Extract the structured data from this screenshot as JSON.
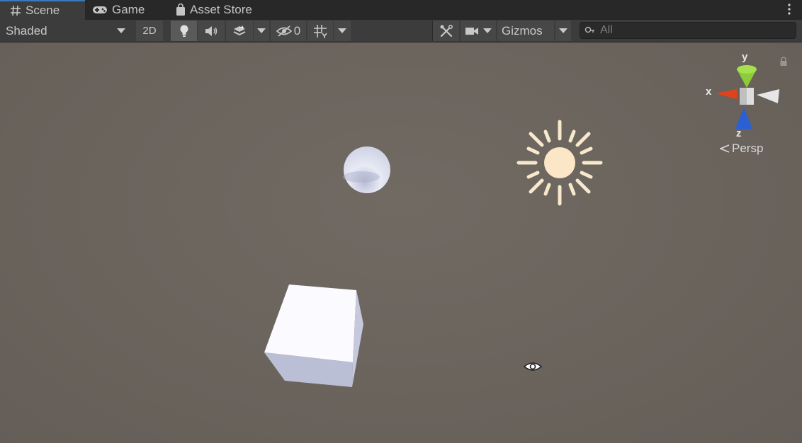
{
  "tabs": [
    {
      "label": "Scene",
      "icon": "grid-hash-icon",
      "active": true
    },
    {
      "label": "Game",
      "icon": "gamepad-icon",
      "active": false
    },
    {
      "label": "Asset Store",
      "icon": "shopping-bag-icon",
      "active": false
    }
  ],
  "toolbar": {
    "draw_mode": "Shaded",
    "mode_2d": "2D",
    "hidden_count": "0",
    "gizmos_label": "Gizmos",
    "search_placeholder": "All"
  },
  "viewport": {
    "axis_labels": {
      "y": "y",
      "x": "x",
      "z": "z"
    },
    "projection": "Persp"
  },
  "colors": {
    "tab_bar": "#282828",
    "toolbar": "#3c3c3c",
    "viewport_bg": "#6b645d",
    "x_axis": "#e0421c",
    "y_axis": "#8ccc3a",
    "z_axis": "#2a5fd6",
    "sun": "#f8e8cc"
  }
}
